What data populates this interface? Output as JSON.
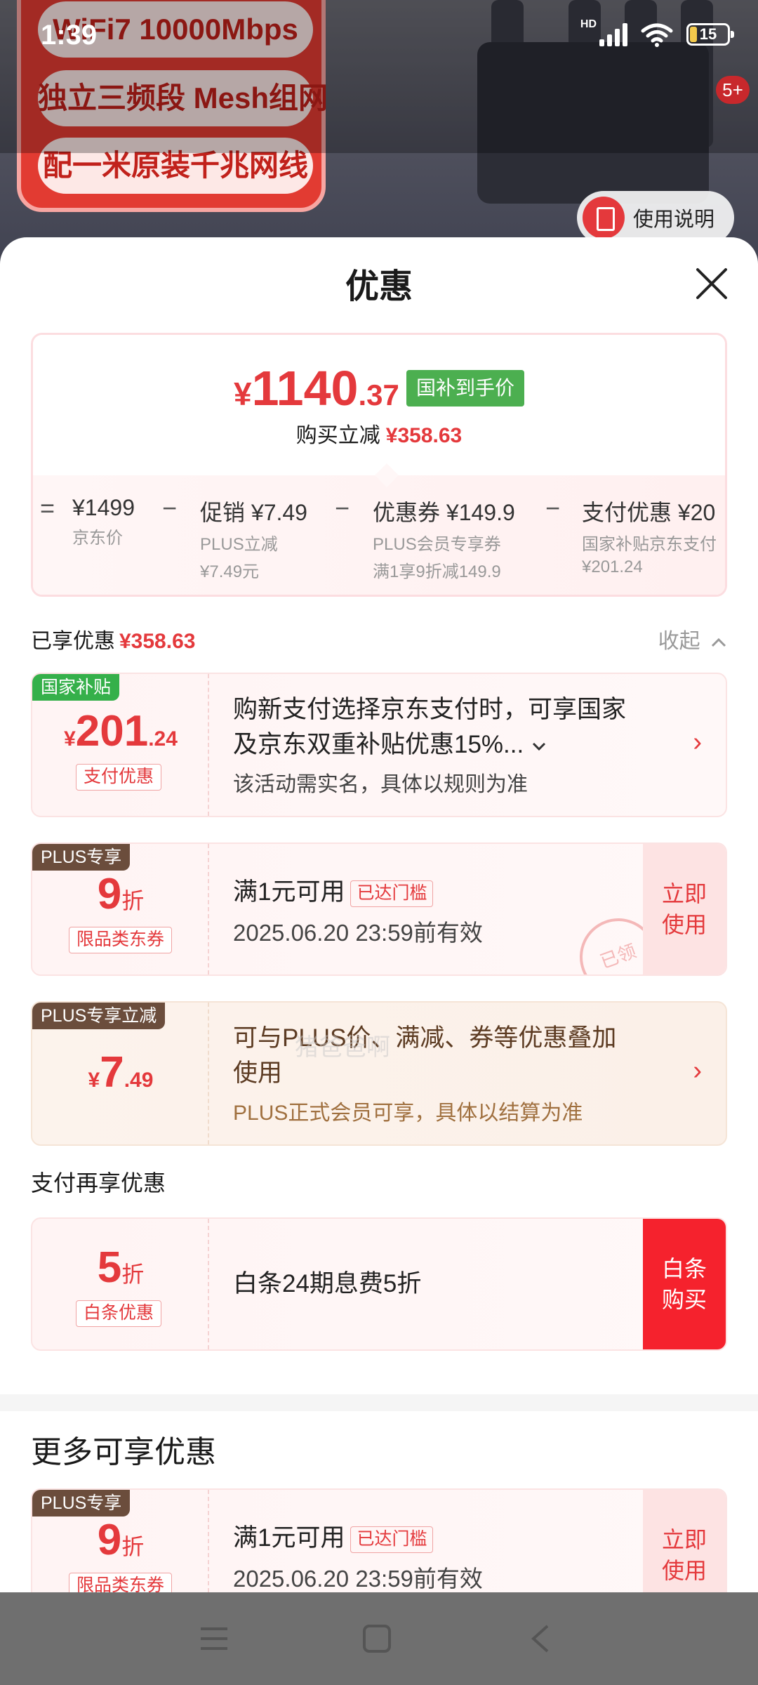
{
  "status": {
    "time": "1:39",
    "hd": "HD",
    "battery": "15"
  },
  "background": {
    "promo_lines": [
      "WiFi7 10000Mbps",
      "独立三频段 Mesh组网",
      "配一米原装千兆网线"
    ],
    "badge": "5+",
    "usage_button": "使用说明"
  },
  "sheet": {
    "title": "优惠",
    "price": {
      "yen": "¥",
      "integer": "1140",
      "decimal": ".37",
      "tag": "国补到手价",
      "save_label": "购买立减",
      "save_value": "¥358.63"
    },
    "breakdown": [
      {
        "title": "¥1499",
        "sub1": "京东价",
        "sub2": ""
      },
      {
        "title": "促销 ¥7.49",
        "sub1": "PLUS立减",
        "sub2": "¥7.49元"
      },
      {
        "title": "优惠券 ¥149.9",
        "sub1": "PLUS会员专享券",
        "sub2": "满1享9折减149.9"
      },
      {
        "title": "支付优惠 ¥20",
        "sub1": "国家补贴京东支付",
        "sub2": "¥201.24"
      }
    ],
    "operators": [
      "=",
      "−",
      "−",
      "−",
      "−"
    ],
    "enjoyed_label": "已享优惠",
    "enjoyed_value": "¥358.63",
    "collapse_label": "收起",
    "offers": [
      {
        "corner": "国家补贴",
        "yen": "¥",
        "amount": "201",
        "decimal": ".24",
        "tag": "支付优惠",
        "line1": "购新支付选择京东支付时，可享国家",
        "line1b": "及京东双重补贴优惠15%...",
        "line2": "该活动需实名，具体以规则为准"
      },
      {
        "corner": "PLUS专享",
        "amount": "9",
        "unit": "折",
        "tag": "限品类东券",
        "line1": "满1元可用",
        "reach": "已达门槛",
        "line2": "2025.06.20 23:59前有效",
        "action": "立即使用",
        "stamp": "已领"
      },
      {
        "corner": "PLUS专享立减",
        "yen": "¥",
        "amount": "7",
        "decimal": ".49",
        "line1": "可与PLUS价、满减、券等优惠叠加",
        "line1b": "使用",
        "line2": "PLUS正式会员可享，具体以结算为准"
      }
    ],
    "pay_again_label": "支付再享优惠",
    "baitiao": {
      "amount": "5",
      "unit": "折",
      "tag": "白条优惠",
      "line1": "白条24期息费5折",
      "action": "白条购买"
    },
    "more_title": "更多可享优惠",
    "more_offer": {
      "corner": "PLUS专享",
      "amount": "9",
      "unit": "折",
      "tag": "限品类东券",
      "line1": "满1元可用",
      "reach": "已达门槛",
      "line2": "2025.06.20 23:59前有效",
      "action": "立即使用"
    },
    "watermark": "猪爸爸啊"
  },
  "colors": {
    "accent": "#e4393c",
    "green": "#4caf50",
    "plus_brown": "#6b4d3c"
  },
  "icons": [
    "close-icon",
    "chevron-up-icon",
    "chevron-right-icon",
    "chevron-down-icon",
    "menu-icon",
    "home-icon",
    "back-icon"
  ]
}
